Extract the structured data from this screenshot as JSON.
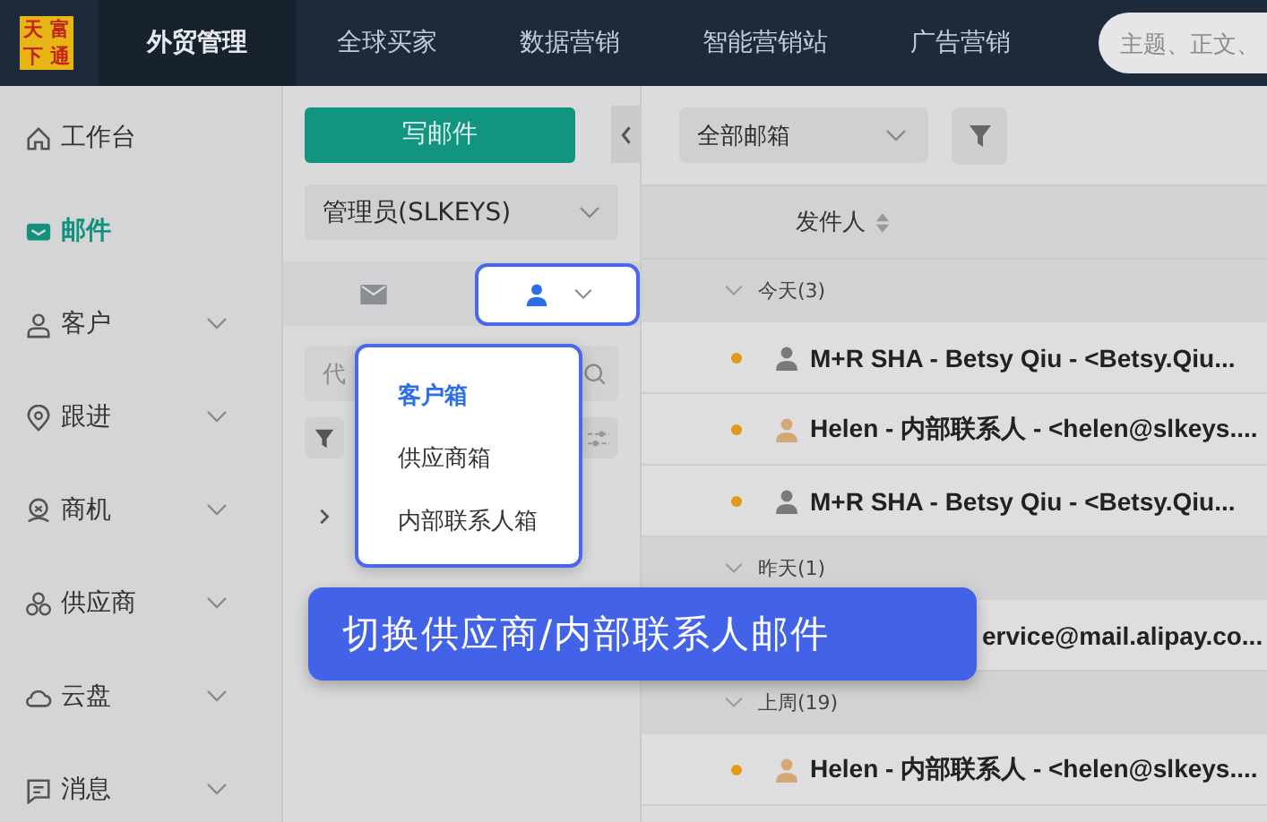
{
  "logo": [
    "天",
    "富",
    "下",
    "通"
  ],
  "top_nav": [
    {
      "label": "外贸管理",
      "selected": true
    },
    {
      "label": "全球买家",
      "selected": false
    },
    {
      "label": "数据营销",
      "selected": false
    },
    {
      "label": "智能营销站",
      "selected": false
    },
    {
      "label": "广告营销",
      "selected": false
    }
  ],
  "search": {
    "placeholder": "主题、正文、"
  },
  "sidebar": {
    "items": [
      {
        "label": "工作台",
        "kind": "link",
        "selected": false
      },
      {
        "label": "邮件",
        "kind": "link",
        "selected": true
      },
      {
        "label": "客户",
        "kind": "group",
        "selected": false
      },
      {
        "label": "跟进",
        "kind": "group",
        "selected": false
      },
      {
        "label": "商机",
        "kind": "group",
        "selected": false
      },
      {
        "label": "供应商",
        "kind": "group",
        "selected": false
      },
      {
        "label": "云盘",
        "kind": "group",
        "selected": false
      },
      {
        "label": "消息",
        "kind": "group",
        "selected": false
      }
    ]
  },
  "mail_panel": {
    "compose_button": "写邮件",
    "account": "管理员(SLKEYS)",
    "search_placeholder": "代",
    "box_menu": {
      "items": [
        {
          "label": "客户箱",
          "selected": true
        },
        {
          "label": "供应商箱",
          "selected": false
        },
        {
          "label": "内部联系人箱",
          "selected": false
        }
      ]
    }
  },
  "mail_list": {
    "mailbox": "全部邮箱",
    "column": "发件人",
    "groups": [
      {
        "label": "今天(3)",
        "rows": [
          {
            "sender": "M+R SHA - Betsy Qiu - <Betsy.Qiu...",
            "color": "#7a7a7c",
            "unread": true
          },
          {
            "sender": "Helen - 内部联系人 - <helen@slkeys....",
            "color": "#d2a877",
            "unread": true
          },
          {
            "sender": "M+R SHA - Betsy Qiu - <Betsy.Qiu...",
            "color": "#7a7a7c",
            "unread": true
          }
        ]
      },
      {
        "label": "昨天(1)",
        "rows": [
          {
            "sender": "ervice@mail.alipay.co..."
          }
        ]
      },
      {
        "label": "上周(19)",
        "rows": [
          {
            "sender": "Helen - 内部联系人 - <helen@slkeys....",
            "color": "#d2a877",
            "unread": true
          }
        ]
      }
    ]
  },
  "tooltip": "切换供应商/内部联系人邮件"
}
